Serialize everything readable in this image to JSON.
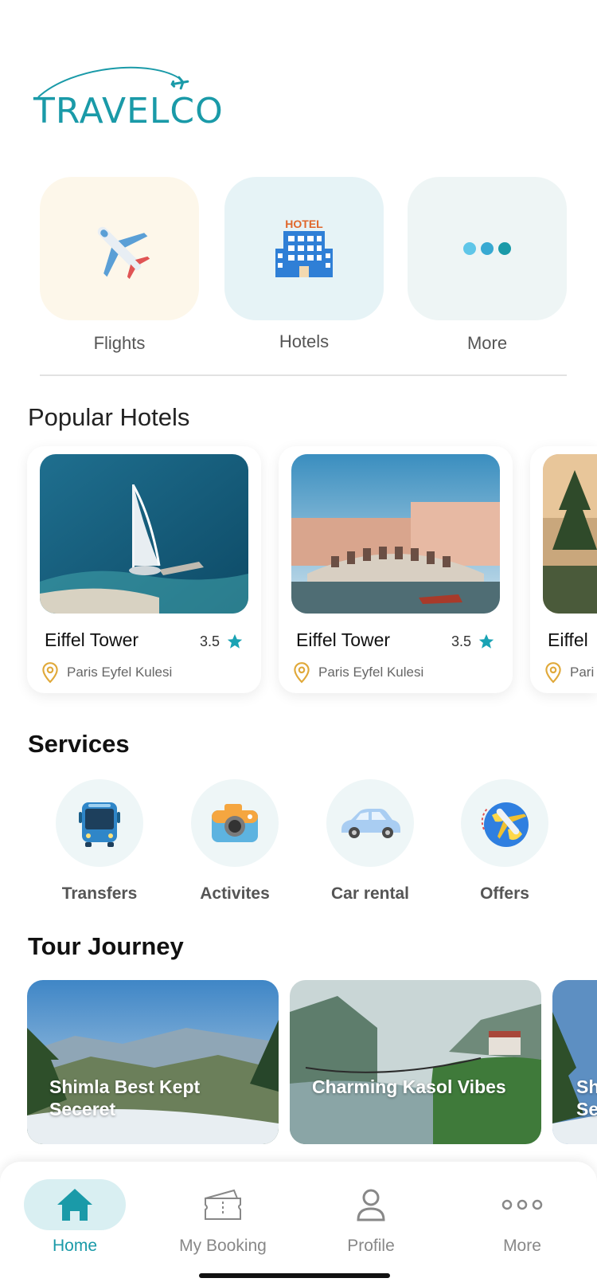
{
  "brand": {
    "logo_text": "TRAVELCO",
    "accent": "#1a9aa8",
    "accent_yellow": "#f2c31b"
  },
  "categories": [
    {
      "label": "Flights",
      "icon": "airplane-icon",
      "bg": "#fdf7ea"
    },
    {
      "label": "Hotels",
      "icon": "hotel-building-icon",
      "bg": "#e6f3f6"
    },
    {
      "label": "More",
      "icon": "more-dots-icon",
      "bg": "#eef5f5"
    }
  ],
  "popular_hotels": {
    "title": "Popular Hotels",
    "items": [
      {
        "name": "Eiffel Tower",
        "rating": "3.5",
        "location": "Paris Eyfel Kulesi"
      },
      {
        "name": "Eiffel Tower",
        "rating": "3.5",
        "location": "Paris Eyfel Kulesi"
      },
      {
        "name": "Eiffel",
        "rating": "",
        "location": "Pari"
      }
    ]
  },
  "services": {
    "title": "Services",
    "items": [
      {
        "label": "Transfers",
        "icon": "bus-icon"
      },
      {
        "label": "Activites",
        "icon": "camera-icon"
      },
      {
        "label": "Car rental",
        "icon": "car-icon"
      },
      {
        "label": "Offers",
        "icon": "globe-plane-icon"
      }
    ]
  },
  "tour_journey": {
    "title": "Tour Journey",
    "items": [
      {
        "title": "Shimla Best Kept Seceret"
      },
      {
        "title": "Charming Kasol Vibes"
      },
      {
        "title": "Sh Se"
      }
    ]
  },
  "bottom_nav": {
    "items": [
      {
        "label": "Home",
        "icon": "home-icon",
        "active": true
      },
      {
        "label": "My Booking",
        "icon": "ticket-icon",
        "active": false
      },
      {
        "label": "Profile",
        "icon": "user-icon",
        "active": false
      },
      {
        "label": "More",
        "icon": "more-dots-icon",
        "active": false
      }
    ]
  },
  "colors": {
    "star": "#1aa3b4",
    "pin": "#e0a93a"
  }
}
